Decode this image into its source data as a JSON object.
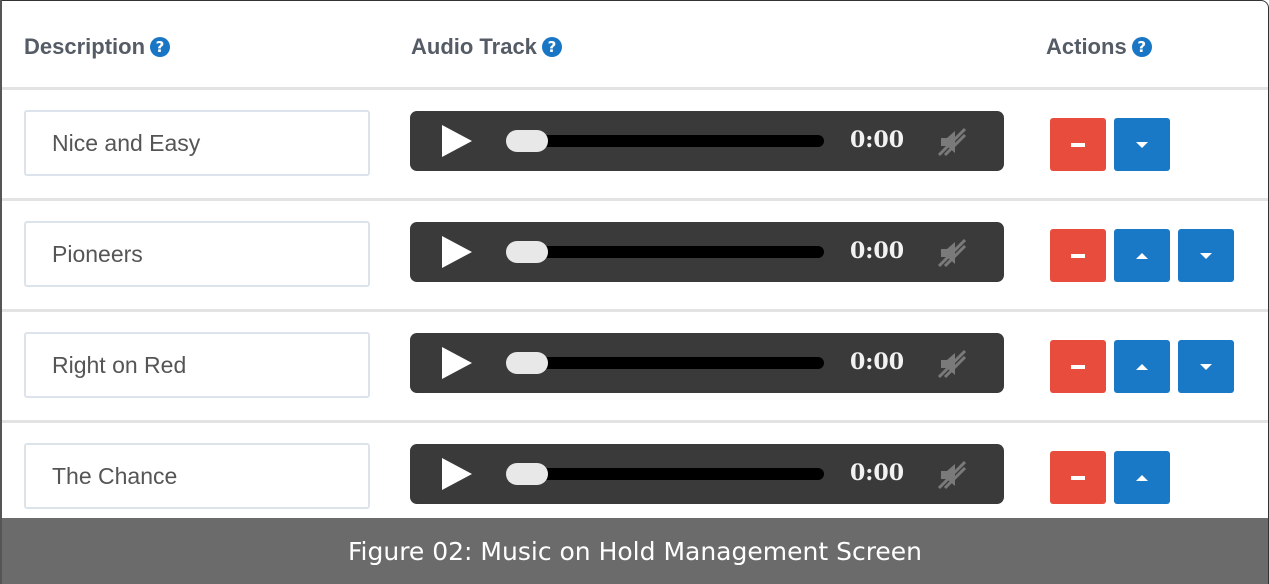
{
  "table": {
    "headers": {
      "description": "Description",
      "audio_track": "Audio Track",
      "actions": "Actions",
      "help_glyph": "?"
    },
    "rows": [
      {
        "description": "Nice and Easy",
        "time": "0:00",
        "progress": 0,
        "actions": [
          "remove",
          "move-down"
        ]
      },
      {
        "description": "Pioneers",
        "time": "0:00",
        "progress": 0,
        "actions": [
          "remove",
          "move-up",
          "move-down"
        ]
      },
      {
        "description": "Right on Red",
        "time": "0:00",
        "progress": 0,
        "actions": [
          "remove",
          "move-up",
          "move-down"
        ]
      },
      {
        "description": "The Chance",
        "time": "0:00",
        "progress": 0,
        "actions": [
          "remove",
          "move-up"
        ]
      }
    ]
  },
  "caption": "Figure 02: Music on Hold Management Screen",
  "colors": {
    "remove_button": "#e74c3c",
    "move_button": "#1a79c7",
    "player_bg": "#3a3a3a",
    "help_icon": "#1976c5",
    "caption_bg": "#6b6b6b"
  },
  "icons": {
    "help": "question-circle-icon",
    "play": "play-icon",
    "mute": "volume-mute-icon",
    "remove": "minus-icon",
    "move_up": "caret-up-icon",
    "move_down": "caret-down-icon"
  }
}
